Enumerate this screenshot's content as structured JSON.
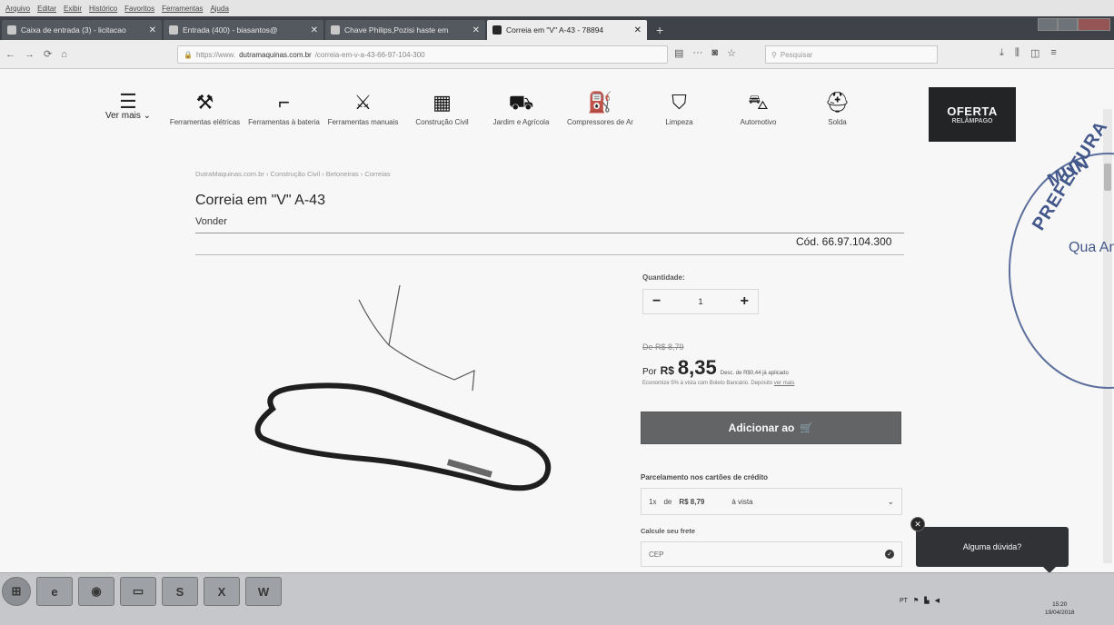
{
  "browser": {
    "menu": [
      "Arquivo",
      "Editar",
      "Exibir",
      "Histórico",
      "Favoritos",
      "Ferramentas",
      "Ajuda"
    ],
    "tabs": [
      {
        "label": "Caixa de entrada (3) - licitacao",
        "active": false
      },
      {
        "label": "Entrada (400) - biasantos@",
        "active": false
      },
      {
        "label": "Chave Philips,Pozisi haste em",
        "active": false
      },
      {
        "label": "Correia em \"V\" A-43 - 78894",
        "active": true
      }
    ],
    "url_prefix": "https://www.",
    "url_domain": "dutramaquinas.com.br",
    "url_path": "/correia-em-v-a-43-66-97-104-300",
    "search_placeholder": "Pesquisar"
  },
  "site": {
    "ver_mais": "Ver mais",
    "categories": [
      {
        "label": "Ferramentas elétricas",
        "icon": "drill-icon"
      },
      {
        "label": "Ferramentas à bateria",
        "icon": "battery-drill-icon"
      },
      {
        "label": "Ferramentas manuais",
        "icon": "hand-tools-icon"
      },
      {
        "label": "Construção Civil",
        "icon": "bricks-icon"
      },
      {
        "label": "Jardim e Agrícola",
        "icon": "lawnmower-icon"
      },
      {
        "label": "Compressores de Ar",
        "icon": "compressor-icon"
      },
      {
        "label": "Limpeza",
        "icon": "bucket-icon"
      },
      {
        "label": "Automotivo",
        "icon": "car-lift-icon"
      },
      {
        "label": "Solda",
        "icon": "welding-mask-icon"
      }
    ],
    "oferta_title": "OFERTA",
    "oferta_sub": "RELÂMPAGO"
  },
  "product": {
    "breadcrumb": "DutraMaquinas.com.br › Construção Civil › Betoneiras › Correias",
    "title": "Correia em \"V\" A-43",
    "brand": "Vonder",
    "code": "Cód. 66.97.104.300",
    "quantity_label": "Quantidade:",
    "quantity_value": "1",
    "old_price": "De R$ 8,79",
    "price_prefix": "Por",
    "currency": "R$",
    "price": "8,35",
    "discount_note": "Desc. de R$0,44 já aplicado",
    "boleto_note": "Economize 5% à vista com Boleto Bancário. Depósito",
    "boleto_link": "ver mais",
    "add_button": "Adicionar ao",
    "installments_title": "Parcelamento nos cartões de crédito",
    "installment_times": "1x",
    "installment_de": "de",
    "installment_value": "R$ 8,79",
    "installment_mode": "à vista",
    "shipping_title": "Calcule seu frete",
    "cep_placeholder": "CEP"
  },
  "chat": {
    "label": "Alguma dúvida?"
  },
  "stamp": {
    "line1": "PREFEITURA",
    "line2": "MUN",
    "line3": "Qua An Do N°"
  },
  "taskbar": {
    "clock_time": "15:20",
    "clock_date": "19/04/2018"
  }
}
